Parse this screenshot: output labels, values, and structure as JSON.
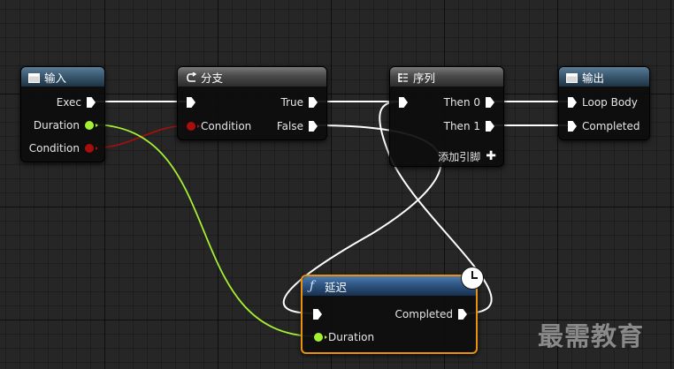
{
  "nodes": {
    "input": {
      "title": "输入",
      "pins": {
        "exec": "Exec",
        "duration": "Duration",
        "condition": "Condition"
      }
    },
    "branch": {
      "title": "分支",
      "pins": {
        "condition": "Condition",
        "true": "True",
        "false": "False"
      }
    },
    "sequence": {
      "title": "序列",
      "pins": {
        "then0": "Then 0",
        "then1": "Then 1",
        "add_pin": "添加引脚"
      }
    },
    "output": {
      "title": "输出",
      "pins": {
        "loop_body": "Loop Body",
        "completed": "Completed"
      }
    },
    "delay": {
      "title": "延迟",
      "pins": {
        "completed": "Completed",
        "duration": "Duration"
      }
    }
  },
  "watermark": "最需教育",
  "colors": {
    "exec_wire": "#ffffff",
    "float_wire": "#a6f033",
    "bool_wire": "#a80e0e",
    "delay_border": "#e8920e",
    "background": "#262626"
  },
  "icons": {
    "input": "function-entry-icon",
    "branch": "branch-icon",
    "sequence": "sequence-icon",
    "output": "function-result-icon",
    "delay": "function-icon",
    "latent": "clock-icon"
  }
}
